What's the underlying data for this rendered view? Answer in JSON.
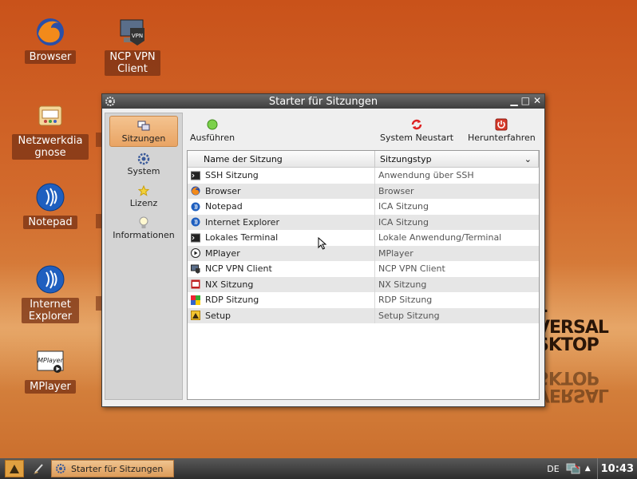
{
  "desktop": {
    "icons": [
      {
        "label": "Browser",
        "icon": "firefox-icon"
      },
      {
        "label": "NCP VPN Client",
        "icon": "vpn-icon"
      },
      {
        "label": "Netzwerkdiagnose",
        "icon": "network-diagnosis-icon"
      },
      {
        "label": "Notepad",
        "icon": "citrix-icon"
      },
      {
        "label": "Internet Explorer",
        "icon": "citrix-icon"
      },
      {
        "label": "MPlayer",
        "icon": "mplayer-icon"
      }
    ],
    "brand_lines": [
      "L",
      "VERSAL",
      "SKTOP"
    ]
  },
  "window": {
    "title": "Starter für Sitzungen",
    "sidebar": [
      {
        "label": "Sitzungen",
        "icon": "sessions-icon",
        "active": true
      },
      {
        "label": "System",
        "icon": "gear-icon",
        "active": false
      },
      {
        "label": "Lizenz",
        "icon": "star-icon",
        "active": false
      },
      {
        "label": "Informationen",
        "icon": "bulb-icon",
        "active": false
      }
    ],
    "toolbar": {
      "run_label": "Ausführen",
      "restart_label": "System Neustart",
      "shutdown_label": "Herunterfahren"
    },
    "table": {
      "col_name": "Name der Sitzung",
      "col_type": "Sitzungstyp",
      "rows": [
        {
          "name": "SSH Sitzung",
          "type": "Anwendung über SSH",
          "icon": "terminal-icon"
        },
        {
          "name": "Browser",
          "type": "Browser",
          "icon": "firefox-icon"
        },
        {
          "name": "Notepad",
          "type": "ICA Sitzung",
          "icon": "citrix-icon"
        },
        {
          "name": "Internet Explorer",
          "type": "ICA Sitzung",
          "icon": "citrix-icon"
        },
        {
          "name": "Lokales Terminal",
          "type": "Lokale Anwendung/Terminal",
          "icon": "terminal-icon"
        },
        {
          "name": "MPlayer",
          "type": "MPlayer",
          "icon": "play-icon"
        },
        {
          "name": "NCP VPN Client",
          "type": "NCP VPN Client",
          "icon": "vpn-icon"
        },
        {
          "name": "NX Sitzung",
          "type": "NX Sitzung",
          "icon": "nx-icon"
        },
        {
          "name": "RDP Sitzung",
          "type": "RDP Sitzung",
          "icon": "rdp-icon"
        },
        {
          "name": "Setup",
          "type": "Setup Sitzung",
          "icon": "setup-icon"
        }
      ]
    }
  },
  "taskbar": {
    "task_label": "Starter für Sitzungen",
    "language": "DE",
    "clock": "10:43"
  }
}
